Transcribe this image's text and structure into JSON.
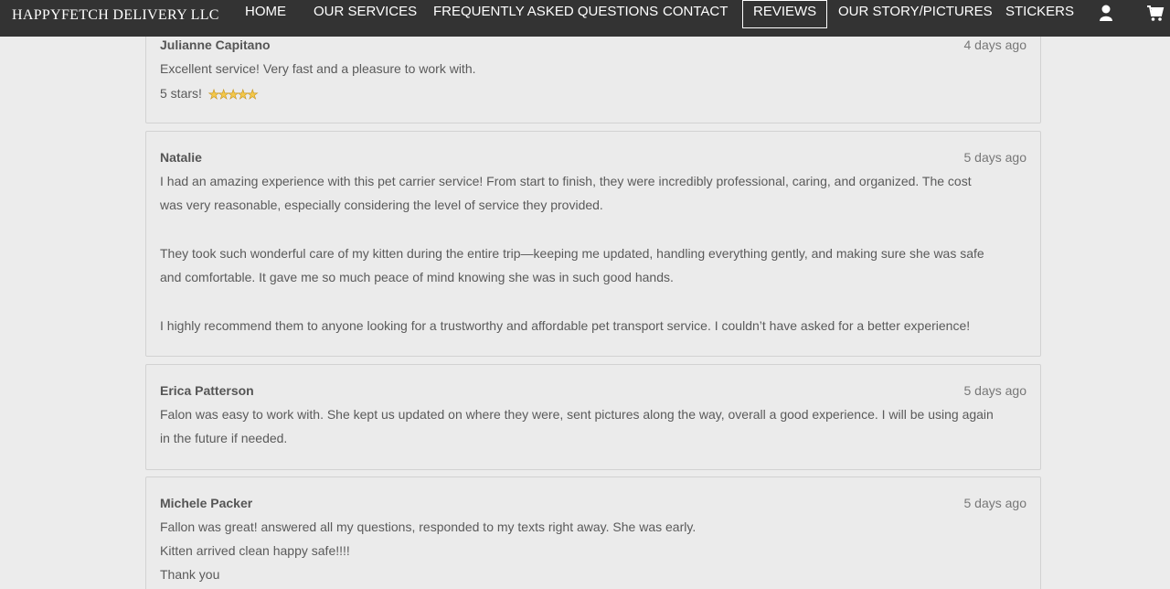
{
  "brand": "HAPPYFETCH DELIVERY LLC",
  "nav": {
    "home": "HOME",
    "services": "OUR SERVICES",
    "faq": "FREQUENTLY ASKED QUESTIONS",
    "contact": "CONTACT",
    "reviews": "REVIEWS",
    "story": "OUR STORY/PICTURES",
    "stickers": "STICKERS",
    "account_icon": "user-icon",
    "cart_icon": "cart-icon"
  },
  "colors": {
    "navbar": "#333333",
    "page_bg": "#ececec",
    "star": "#f4c84a"
  },
  "reviews": [
    {
      "name": "Julianne Capitano",
      "date": "4 days ago",
      "lines": [
        "Excellent service! Very fast and a pleasure to work with.",
        "5 stars!"
      ],
      "stars": 5
    },
    {
      "name": "Natalie",
      "date": "5 days ago",
      "lines": [
        "I had an amazing experience with this pet carrier service! From start to finish, they were incredibly professional, caring, and organized. The cost",
        "was very reasonable, especially considering the level of service they provided.",
        "They took such wonderful care of my kitten during the entire trip—keeping me updated, handling everything gently, and making sure she was safe",
        "and comfortable. It gave me so much peace of mind knowing she was in such good hands.",
        "I highly recommend them to anyone looking for a trustworthy and affordable pet transport service. I couldn’t have asked for a better experience!"
      ]
    },
    {
      "name": "Erica Patterson",
      "date": "5 days ago",
      "lines": [
        "Falon was easy to work with. She kept us updated on where they were, sent pictures along the way, overall a good experience. I will be using again",
        "in the future if needed."
      ]
    },
    {
      "name": "Michele Packer",
      "date": "5 days ago",
      "lines": [
        "Fallon was great! answered all my questions, responded to my texts right away. She was early.",
        "Kitten arrived clean happy safe!!!!",
        "Thank you"
      ]
    }
  ]
}
